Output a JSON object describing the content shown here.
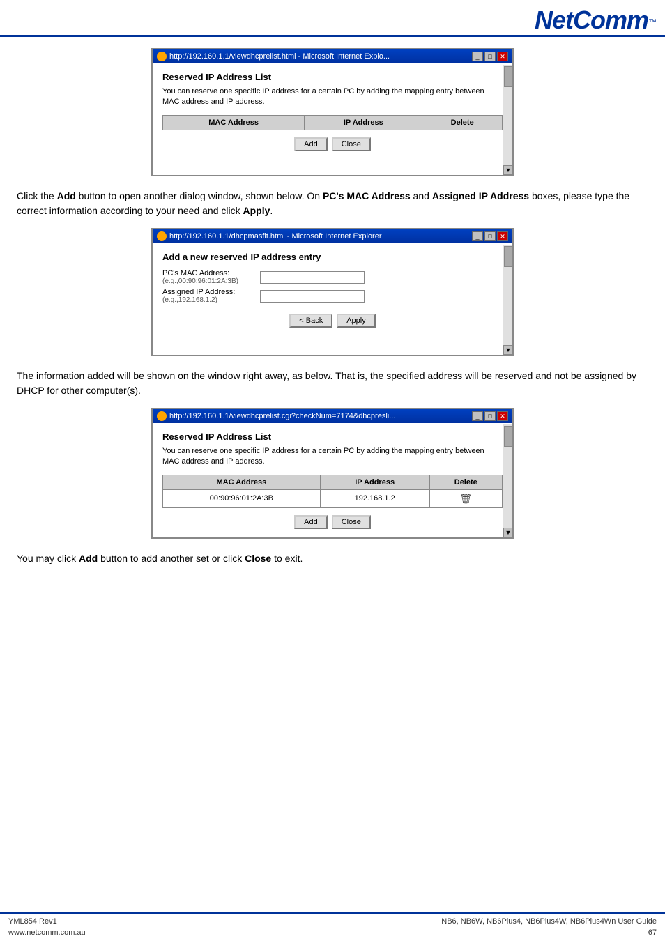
{
  "header": {
    "logo": "NetComm",
    "tm": "™",
    "accent_color": "#003399"
  },
  "para1": {
    "text_before": "Click the ",
    "add_bold": "Add",
    "text_middle": " button to open another dialog window, shown below. On ",
    "mac_bold": "PC's MAC Address",
    "text_and": " and ",
    "ip_bold": "Assigned IP Address",
    "text_after": " boxes, please type the correct information according to your need and click ",
    "apply_bold": "Apply",
    "text_end": "."
  },
  "para2": {
    "text": "The information added will be shown on the window right away, as below. That is, the specified address will be reserved and not be assigned by DHCP for other computer(s)."
  },
  "para3": {
    "text_before": "You may click ",
    "add_bold": "Add",
    "text_middle": " button to add another set or click ",
    "close_bold": "Close",
    "text_after": " to exit."
  },
  "window1": {
    "title": "http://192.160.1.1/viewdhcprelist.html - Microsoft Internet Explo...",
    "section_title": "Reserved IP Address List",
    "description": "You can reserve one specific IP address for a certain PC by adding the mapping entry between MAC address and IP address.",
    "table": {
      "headers": [
        "MAC Address",
        "IP Address",
        "Delete"
      ],
      "rows": []
    },
    "buttons": {
      "add": "Add",
      "close": "Close"
    }
  },
  "window2": {
    "title": "http://192.160.1.1/dhcpmasflt.html - Microsoft Internet Explorer",
    "section_title": "Add a new reserved IP address entry",
    "mac_label": "PC's MAC Address:",
    "mac_sublabel": "(e.g.,00:90:96:01:2A:3B)",
    "ip_label": "Assigned IP Address:",
    "ip_sublabel": "(e.g.,192.168.1.2)",
    "buttons": {
      "back": "< Back",
      "apply": "Apply"
    }
  },
  "window3": {
    "title": "http://192.160.1.1/viewdhcprelist.cgi?checkNum=7174&dhcpresli...",
    "section_title": "Reserved IP Address List",
    "description": "You can reserve one specific IP address for a certain PC by adding the mapping entry between MAC address and IP address.",
    "table": {
      "headers": [
        "MAC Address",
        "IP Address",
        "Delete"
      ],
      "rows": [
        {
          "mac": "00:90:96:01:2A:3B",
          "ip": "192.168.1.2",
          "delete": "🗑"
        }
      ]
    },
    "buttons": {
      "add": "Add",
      "close": "Close"
    }
  },
  "footer": {
    "left_line1": "YML854 Rev1",
    "left_line2": "www.netcomm.com.au",
    "right_line1": "NB6, NB6W, NB6Plus4, NB6Plus4W, NB6Plus4Wn User Guide",
    "right_line2": "67"
  }
}
